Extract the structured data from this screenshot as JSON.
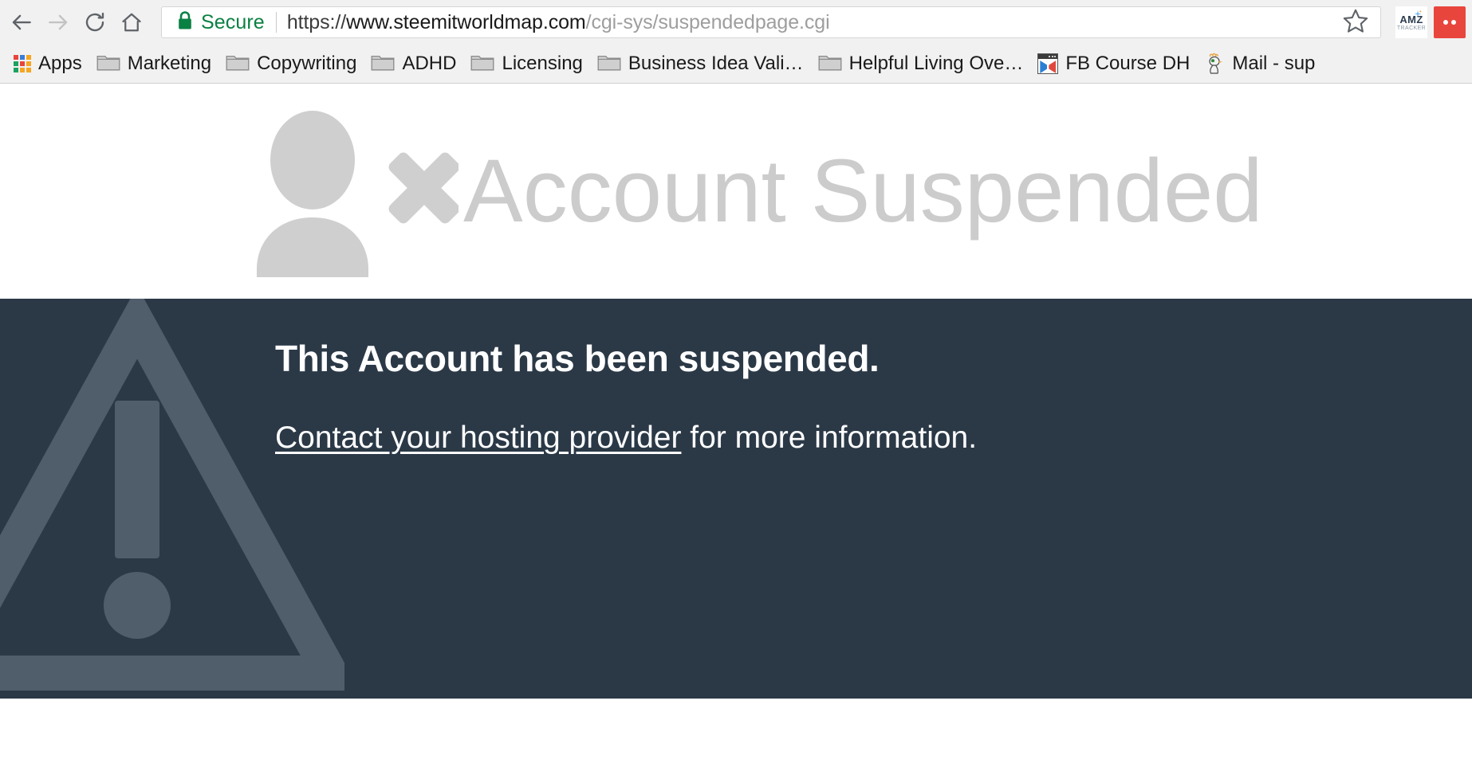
{
  "browser": {
    "nav": {
      "back_icon": "arrow-left-icon",
      "forward_icon": "arrow-right-icon",
      "reload_icon": "reload-icon",
      "home_icon": "home-icon"
    },
    "omnibox": {
      "security_label": "Secure",
      "lock_icon": "lock-icon",
      "url_scheme": "https://",
      "url_host": "www.steemitworldmap.com",
      "url_path": "/cgi-sys/suspendedpage.cgi",
      "url_full": "https://www.steemitworldmap.com/cgi-sys/suspendedpage.cgi",
      "star_icon": "star-icon",
      "secure_color": "#0b8043"
    },
    "extensions": [
      {
        "name": "amz-tracker-extension",
        "top_text": "AMZ",
        "bottom_text": "TRACKER"
      },
      {
        "name": "red-menu-extension",
        "label": ""
      }
    ],
    "bookmarks": [
      {
        "name": "bookmark-apps",
        "label": "Apps",
        "icon": "apps-grid-icon"
      },
      {
        "name": "bookmark-marketing",
        "label": "Marketing",
        "icon": "folder-icon"
      },
      {
        "name": "bookmark-copywriting",
        "label": "Copywriting",
        "icon": "folder-icon"
      },
      {
        "name": "bookmark-adhd",
        "label": "ADHD",
        "icon": "folder-icon"
      },
      {
        "name": "bookmark-licensing",
        "label": "Licensing",
        "icon": "folder-icon"
      },
      {
        "name": "bookmark-business",
        "label": "Business Idea Vali…",
        "icon": "folder-icon"
      },
      {
        "name": "bookmark-helpful",
        "label": "Helpful Living Ove…",
        "icon": "folder-icon"
      },
      {
        "name": "bookmark-fbcourse",
        "label": "FB Course DH",
        "icon": "fb-course-icon"
      },
      {
        "name": "bookmark-mail",
        "label": "Mail - sup",
        "icon": "mail-bird-icon"
      }
    ],
    "apps_grid_colors": [
      "#e8453c",
      "#3b7dd8",
      "#f5a623",
      "#1aa260",
      "#e8453c",
      "#f5a623",
      "#1aa260",
      "#f5a623",
      "#f5a623"
    ]
  },
  "page": {
    "hero": {
      "icon": "user-suspended-icon",
      "title": "Account Suspended",
      "title_color": "#cccccc"
    },
    "banner": {
      "background_color": "#2b3947",
      "triangle_color": "#505d6b",
      "warning_icon": "warning-triangle-icon",
      "heading": "This Account has been suspended.",
      "link_text": "Contact your hosting provider",
      "after_link_text": " for more information."
    }
  }
}
